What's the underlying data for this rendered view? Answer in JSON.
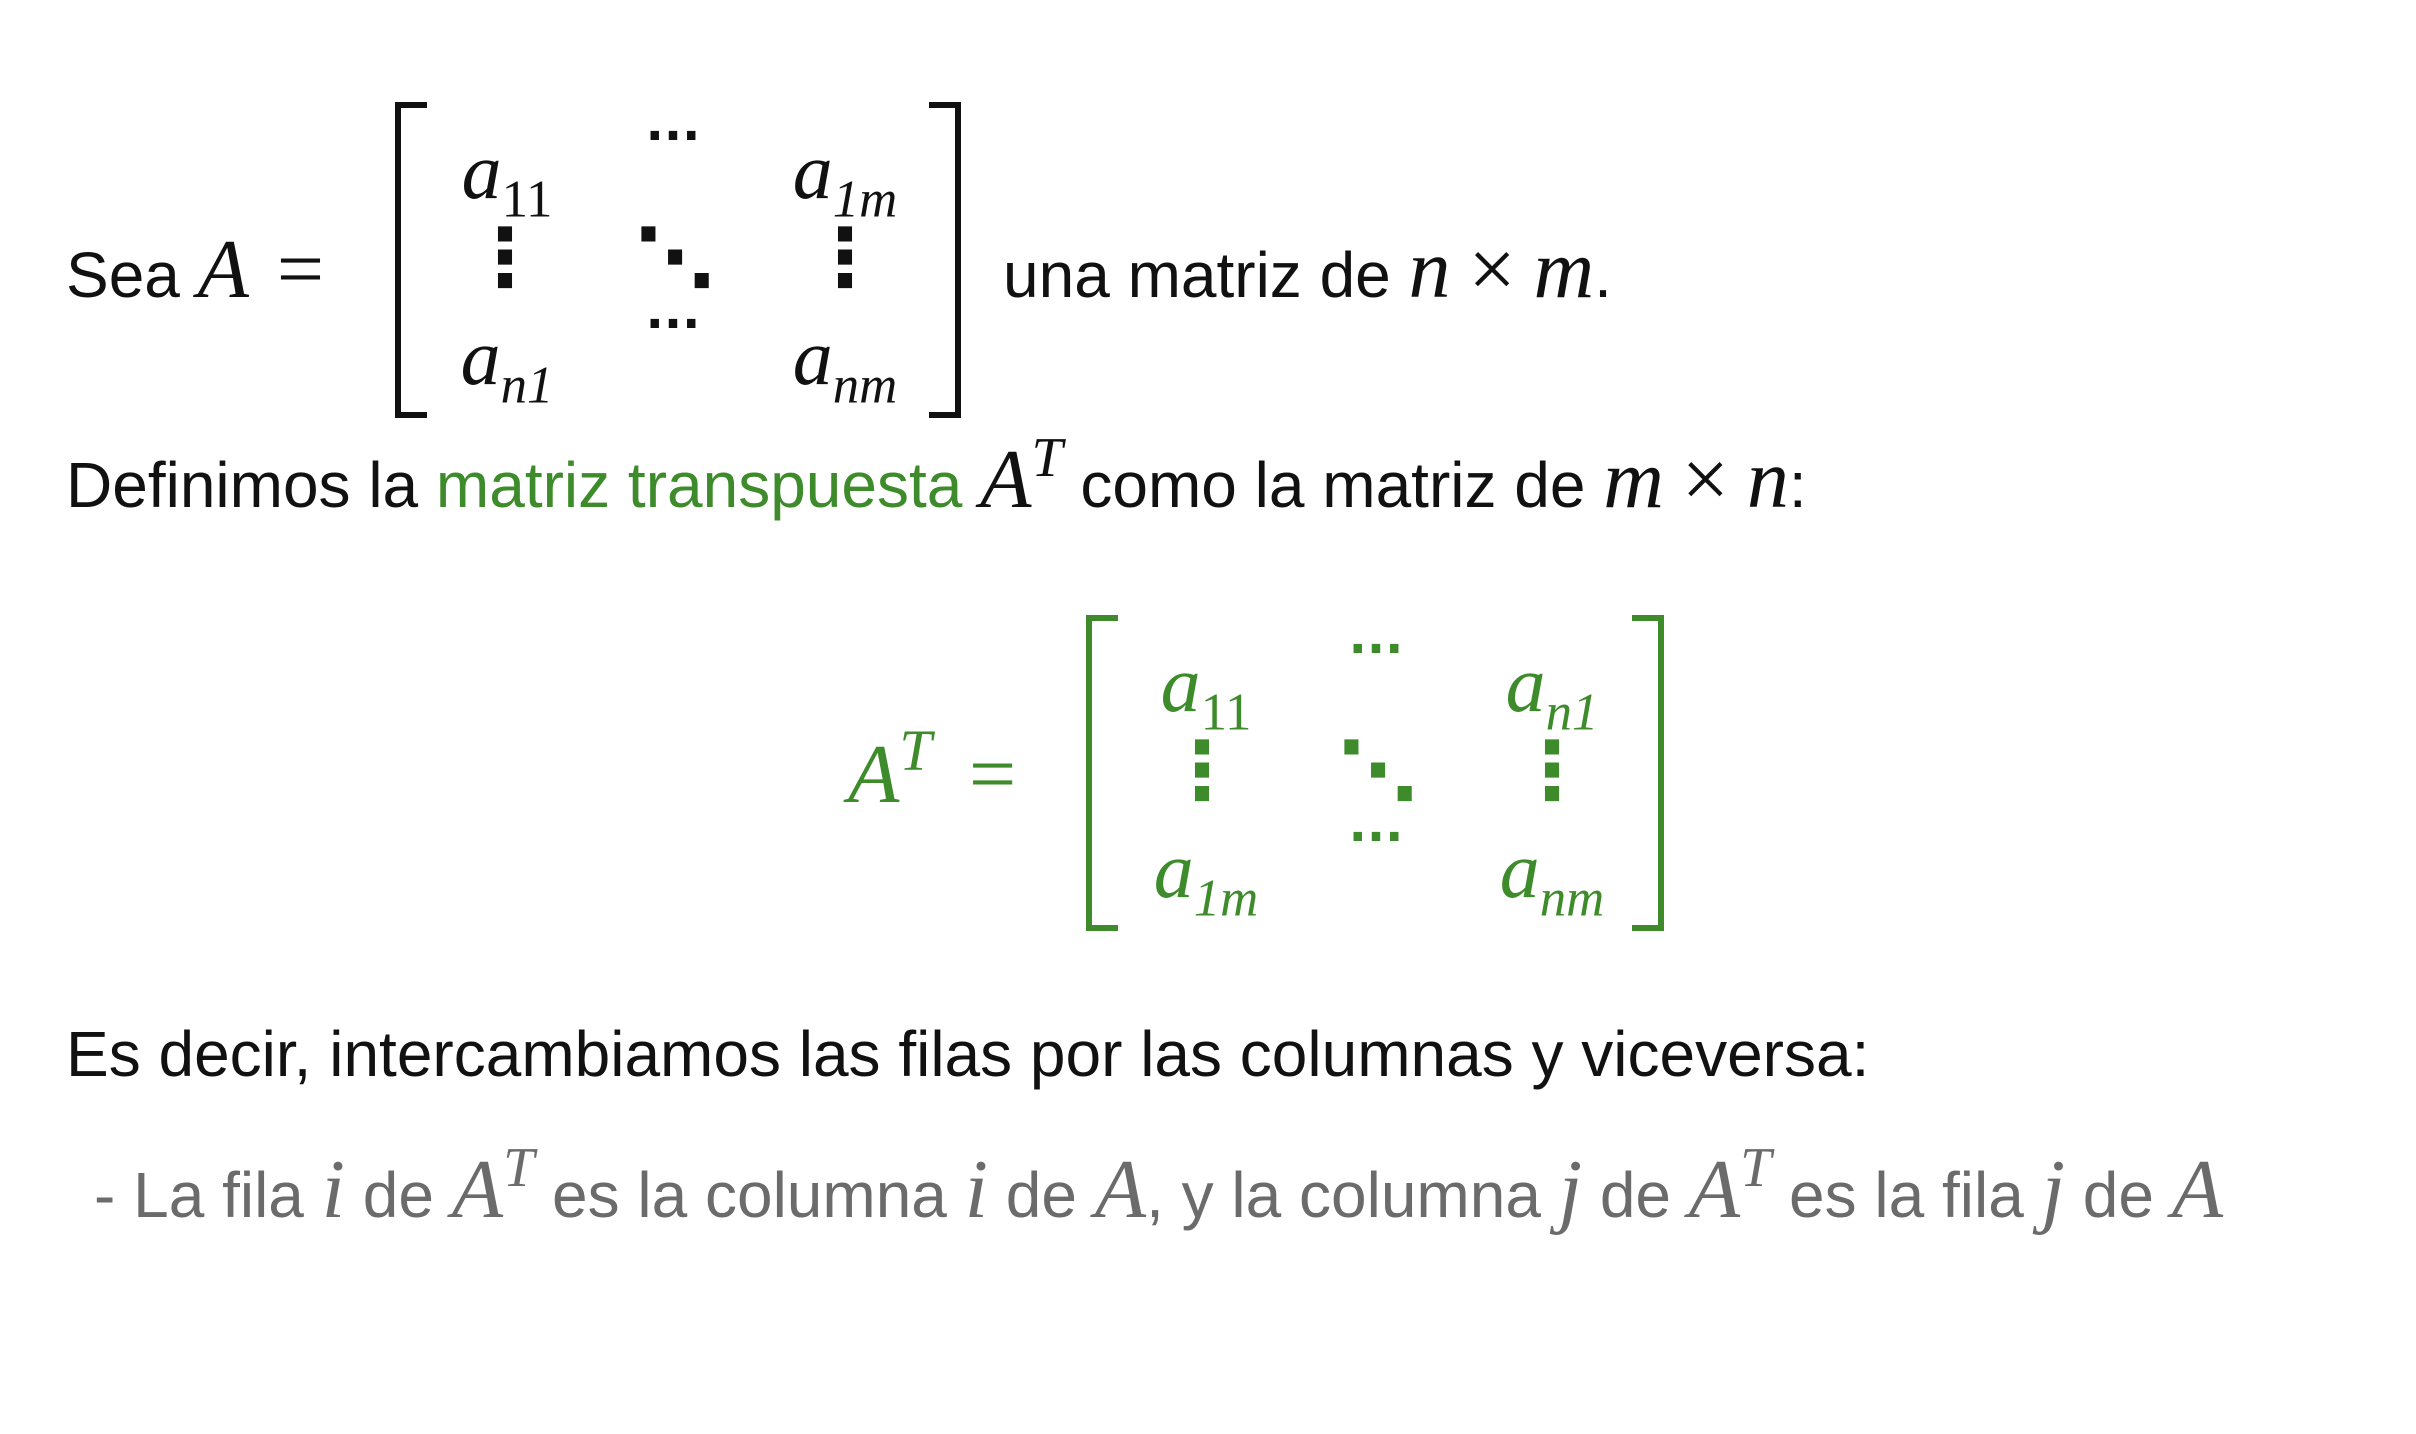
{
  "line1": {
    "prefix": "Sea",
    "A": "A",
    "eq": "=",
    "suffix": "una matriz de",
    "n": "n",
    "times": "×",
    "m": "m",
    "end": "."
  },
  "matrix_A": {
    "r1c1": {
      "base": "a",
      "sub": "11"
    },
    "r1c2": "···",
    "r1c3": {
      "base": "a",
      "sub": "1m"
    },
    "r2c1": "⋮",
    "r2c2": "⋱",
    "r2c3": "⋮",
    "r3c1": {
      "base": "a",
      "sub": "n1"
    },
    "r3c2": "···",
    "r3c3": {
      "base": "a",
      "sub": "nm"
    }
  },
  "line2": {
    "prefix": "Definimos la",
    "highlight": "matriz transpuesta",
    "A": "A",
    "T": "T",
    "middle": "como la matriz de",
    "m": "m",
    "times": "×",
    "n": "n",
    "end": ":"
  },
  "transpose_eq": {
    "A": "A",
    "T": "T",
    "eq": "="
  },
  "matrix_AT": {
    "r1c1": {
      "base": "a",
      "sub": "11"
    },
    "r1c2": "···",
    "r1c3": {
      "base": "a",
      "sub": "n1"
    },
    "r2c1": "⋮",
    "r2c2": "⋱",
    "r2c3": "⋮",
    "r3c1": {
      "base": "a",
      "sub": "1m"
    },
    "r3c2": "···",
    "r3c3": {
      "base": "a",
      "sub": "nm"
    }
  },
  "line3": "Es decir, intercambiamos las filas por las columnas y viceversa:",
  "line4": {
    "p1": "- La fila",
    "i1": "i",
    "p2": "de",
    "A1": "A",
    "T1": "T",
    "p3": "es la columna",
    "i2": "i",
    "p4": "de",
    "A2": "A",
    "p5": ", y la columna",
    "j1": "j",
    "p6": "de",
    "A3": "A",
    "T2": "T",
    "p7": "es la fila",
    "j2": "j",
    "p8": "de",
    "A4": "A"
  },
  "colors": {
    "text": "#111111",
    "accent_green": "#3d8b2a",
    "note_gray": "#6b6b6b"
  }
}
